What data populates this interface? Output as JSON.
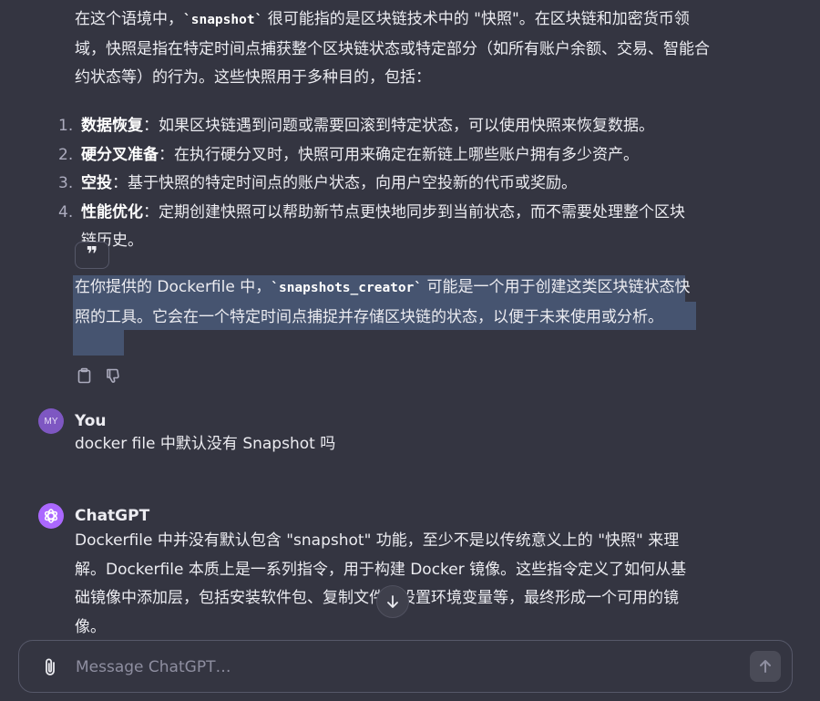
{
  "assistant_prev": {
    "intro_a": "在这个语境中，",
    "intro_code": "`snapshot`",
    "intro_b": " 很可能指的是区块链技术中的 \"快照\"。在区块链和加密货币领域，快照是指在特定时间点捕获整个区块链状态或特定部分（如所有账户余额、交易、智能合约状态等）的行为。这些快照用于多种目的，包括：",
    "list": [
      {
        "num": "1.",
        "title": "数据恢复",
        "text": "：如果区块链遇到问题或需要回滚到特定状态，可以使用快照来恢复数据。"
      },
      {
        "num": "2.",
        "title": "硬分叉准备",
        "text": "：在执行硬分叉时，快照可用来确定在新链上哪些账户拥有多少资产。"
      },
      {
        "num": "3.",
        "title": "空投",
        "text": "：基于快照的特定时间点的账户状态，向用户空投新的代币或奖励。"
      },
      {
        "num": "4.",
        "title": "性能优化",
        "text": "：定期创建快照可以帮助新节点更快地同步到当前状态，而不需要处理整个区块链历史。"
      }
    ],
    "quote_label": "❞",
    "selected_a": "在你提供的 Dockerfile 中，",
    "selected_code": "`snapshots_creator`",
    "selected_b": " 可能是一个用于创建这类区块链状态快照的工具。它会在一个特定时间点捕捉并存储区块链的状态，以便于未来使用或分析。"
  },
  "user_msg": {
    "avatar": "MY",
    "author": "You",
    "text": "docker file 中默认没有 Snapshot 吗"
  },
  "assistant_msg": {
    "author": "ChatGPT",
    "text": "Dockerfile 中并没有默认包含 \"snapshot\" 功能，至少不是以传统意义上的 \"快照\" 来理解。Dockerfile 本质上是一系列指令，用于构建 Docker 镜像。这些指令定义了如何从基础镜像中添加层，包括安装软件包、复制文件、设置环境变量等，最终形成一个可用的镜像。"
  },
  "composer": {
    "placeholder": "Message ChatGPT…"
  },
  "colors": {
    "background": "#343541",
    "selection": "#465470",
    "user_avatar": "#7e57c2",
    "gpt_avatar": "#ab68ff"
  }
}
